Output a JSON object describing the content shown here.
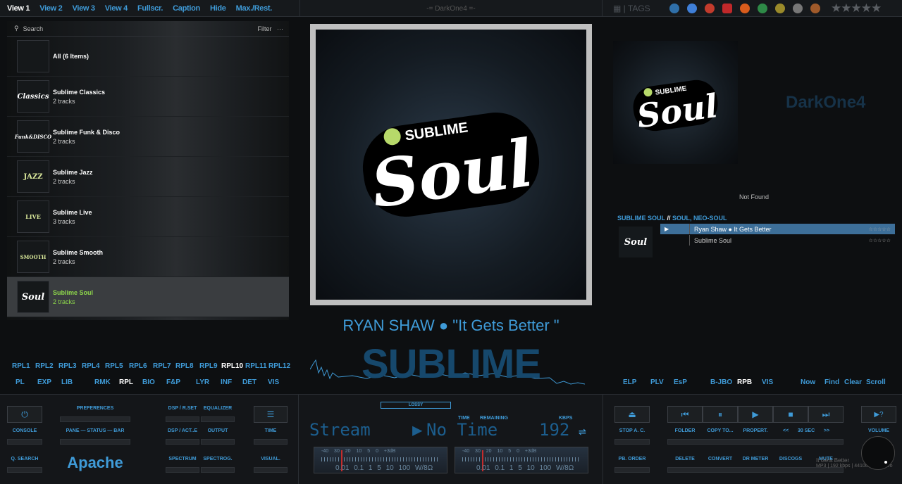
{
  "topnav": {
    "items": [
      "View 1",
      "View 2",
      "View 3",
      "View 4",
      "Fullscr.",
      "Caption",
      "Hide",
      "Max./Rest."
    ]
  },
  "top_center": "-= DarkOne4 =-",
  "tags_label": "TAGS",
  "library": {
    "search_placeholder": "Search",
    "filter": "Filter",
    "more": "···",
    "items": [
      {
        "title": "All (6 Items)",
        "sub": ""
      },
      {
        "title": "Sublime Classics",
        "sub": "2 tracks",
        "logo": "Classics"
      },
      {
        "title": "Sublime Funk & Disco",
        "sub": "2 tracks",
        "logo": "Funk&DISCO"
      },
      {
        "title": "Sublime Jazz",
        "sub": "2 tracks",
        "logo": "JAZZ"
      },
      {
        "title": "Sublime Live",
        "sub": "3 tracks",
        "logo": "LIVE"
      },
      {
        "title": "Sublime Smooth",
        "sub": "2 tracks",
        "logo": "SMOOTH"
      },
      {
        "title": "Sublime Soul",
        "sub": "2 tracks",
        "logo": "Soul"
      }
    ]
  },
  "now_playing": {
    "line": "RYAN SHAW ● \"It Gets Better \"",
    "big": "SUBLIME SOUL",
    "cover_brand": "SUBLIME",
    "cover_word": "Soul"
  },
  "rpl_row1": [
    "RPL1",
    "RPL2",
    "RPL3",
    "RPL4",
    "RPL5",
    "RPL6",
    "RPL7",
    "RPL8",
    "RPL9",
    "RPL10",
    "RPL11",
    "RPL12"
  ],
  "rpl_row2": [
    "PL",
    "EXP",
    "LIB",
    "RMK",
    "RPL",
    "BIO",
    "F&P",
    "LYR",
    "INF",
    "DET",
    "VIS"
  ],
  "right": {
    "dk4": "DarkOne4",
    "not_found": "Not Found",
    "playlist_head_a": "SUBLIME SOUL",
    "playlist_head_sep": " // ",
    "playlist_head_b": "SOUL, NEO-SOUL",
    "rows": [
      {
        "title": "Ryan Shaw ● It Gets Better",
        "rating": "☆☆☆☆☆"
      },
      {
        "title": "Sublime Soul",
        "rating": "☆☆☆☆☆"
      }
    ],
    "row2": [
      "ELP",
      "PLV",
      "EsP",
      "B-JBO",
      "RPB",
      "VIS",
      "Now",
      "Find",
      "Clear",
      "Scroll"
    ]
  },
  "bottom_left": {
    "labels": [
      "CONSOLE",
      "PREFERENCES",
      "PANE — STATUS — BAR",
      "DSP / R.SET",
      "EQUALIZER",
      "DSP / ACT..E",
      "OUTPUT",
      "TIME",
      "Q. SEARCH",
      "SPECTRUM",
      "SPECTROG.",
      "VISUAL."
    ],
    "apache": "Apache"
  },
  "bottom_center": {
    "lossy": "LOSSY",
    "time": "TIME",
    "remaining": "REMAINING",
    "kbps": "KBPS",
    "stream": "Stream",
    "notime": "No Time",
    "bitrate": "192",
    "meter_top": "-40  30  20  10  5  0 +3dB",
    "meter_bot": "0.01  0.1  1  5 10  100 W/8Ω"
  },
  "bottom_right": {
    "labels": [
      "STOP A. C.",
      "FOLDER",
      "COPY TO...",
      "PROPERT.",
      "<<",
      "30 SEC",
      ">>",
      "VOLUME",
      "PB. ORDER",
      "DELETE",
      "CONVERT",
      "DR METER",
      "DISCOGS",
      "MUTE"
    ],
    "mini_title": "It Gets Better",
    "mini_info": "MP3 | 192 kbps | 44100Hz | Stereo"
  }
}
